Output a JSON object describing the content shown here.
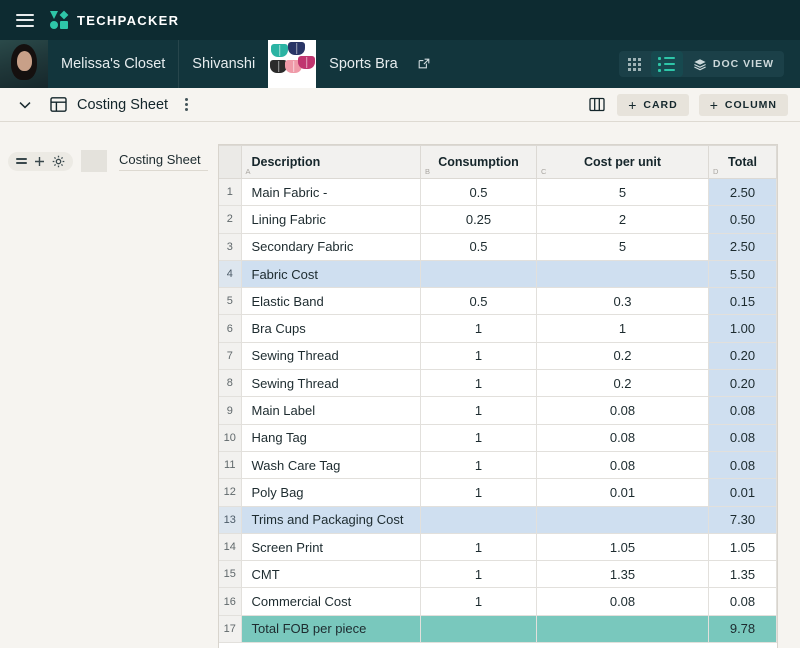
{
  "app": {
    "name": "TECHPACKER",
    "menu_icon": "hamburger-icon",
    "logo_color": "#2ec6a8",
    "navbar_color": "#0d2b31"
  },
  "breadcrumb": {
    "items": [
      {
        "label": "Melissa's Closet",
        "type": "workspace"
      },
      {
        "label": "Shivanshi",
        "type": "folder"
      },
      {
        "label": "Sports Bra",
        "type": "card"
      }
    ],
    "open_external_icon": "external-link-icon"
  },
  "view_toggles": {
    "grid_label": "grid-view",
    "list_label": "list-view",
    "doc_label": "DOC VIEW",
    "active": "list-view",
    "active_color": "#2ec6a8"
  },
  "sheetbar": {
    "collapse_icon": "chevron-down-icon",
    "sheet_icon": "table-layout-icon",
    "title": "Costing Sheet",
    "more_icon": "kebab-menu-icon",
    "columns_icon": "columns-icon",
    "add_card_label": "CARD",
    "add_column_label": "COLUMN",
    "plus": "+"
  },
  "sidebar": {
    "drag_icon": "drag-handle-icon",
    "add_icon": "plus-icon",
    "settings_icon": "gear-icon",
    "items": [
      {
        "label": "Costing Sheet"
      }
    ]
  },
  "table": {
    "columns": [
      {
        "letter": "",
        "label": "",
        "key": "num"
      },
      {
        "letter": "A",
        "label": "Description",
        "key": "desc"
      },
      {
        "letter": "B",
        "label": "Consumption",
        "key": "cons"
      },
      {
        "letter": "C",
        "label": "Cost per unit",
        "key": "cost"
      },
      {
        "letter": "D",
        "label": "Total",
        "key": "tot"
      }
    ],
    "subtotal_color": "#cfdff0",
    "grandtotal_color": "#79c8bd",
    "rows": [
      {
        "n": "1",
        "desc": "Main Fabric -",
        "cons": "0.5",
        "cost": "5",
        "tot": "2.50",
        "style": "normal",
        "tot_fill": "blue"
      },
      {
        "n": "2",
        "desc": "Lining Fabric",
        "cons": "0.25",
        "cost": "2",
        "tot": "0.50",
        "style": "normal",
        "tot_fill": "blue"
      },
      {
        "n": "3",
        "desc": "Secondary Fabric",
        "cons": "0.5",
        "cost": "5",
        "tot": "2.50",
        "style": "normal",
        "tot_fill": "blue"
      },
      {
        "n": "4",
        "desc": "Fabric Cost",
        "cons": "",
        "cost": "",
        "tot": "5.50",
        "style": "sub",
        "tot_fill": "blue"
      },
      {
        "n": "5",
        "desc": "Elastic Band",
        "cons": "0.5",
        "cost": "0.3",
        "tot": "0.15",
        "style": "normal",
        "tot_fill": "blue"
      },
      {
        "n": "6",
        "desc": "Bra Cups",
        "cons": "1",
        "cost": "1",
        "tot": "1.00",
        "style": "normal",
        "tot_fill": "blue"
      },
      {
        "n": "7",
        "desc": "Sewing Thread",
        "cons": "1",
        "cost": "0.2",
        "tot": "0.20",
        "style": "normal",
        "tot_fill": "blue"
      },
      {
        "n": "8",
        "desc": "Sewing Thread",
        "cons": "1",
        "cost": "0.2",
        "tot": "0.20",
        "style": "normal",
        "tot_fill": "blue"
      },
      {
        "n": "9",
        "desc": "Main Label",
        "cons": "1",
        "cost": "0.08",
        "tot": "0.08",
        "style": "normal",
        "tot_fill": "blue"
      },
      {
        "n": "10",
        "desc": "Hang Tag",
        "cons": "1",
        "cost": "0.08",
        "tot": "0.08",
        "style": "normal",
        "tot_fill": "blue"
      },
      {
        "n": "11",
        "desc": "Wash Care Tag",
        "cons": "1",
        "cost": "0.08",
        "tot": "0.08",
        "style": "normal",
        "tot_fill": "blue"
      },
      {
        "n": "12",
        "desc": "Poly Bag",
        "cons": "1",
        "cost": "0.01",
        "tot": "0.01",
        "style": "normal",
        "tot_fill": "blue"
      },
      {
        "n": "13",
        "desc": "Trims and Packaging Cost",
        "cons": "",
        "cost": "",
        "tot": "7.30",
        "style": "sub",
        "tot_fill": "blue"
      },
      {
        "n": "14",
        "desc": "Screen Print",
        "cons": "1",
        "cost": "1.05",
        "tot": "1.05",
        "style": "normal",
        "tot_fill": "white"
      },
      {
        "n": "15",
        "desc": "CMT",
        "cons": "1",
        "cost": "1.35",
        "tot": "1.35",
        "style": "normal",
        "tot_fill": "white"
      },
      {
        "n": "16",
        "desc": "Commercial Cost",
        "cons": "1",
        "cost": "0.08",
        "tot": "0.08",
        "style": "normal",
        "tot_fill": "white"
      },
      {
        "n": "17",
        "desc": "Total FOB per piece",
        "cons": "",
        "cost": "",
        "tot": "9.78",
        "style": "grand",
        "tot_fill": "green"
      }
    ]
  }
}
